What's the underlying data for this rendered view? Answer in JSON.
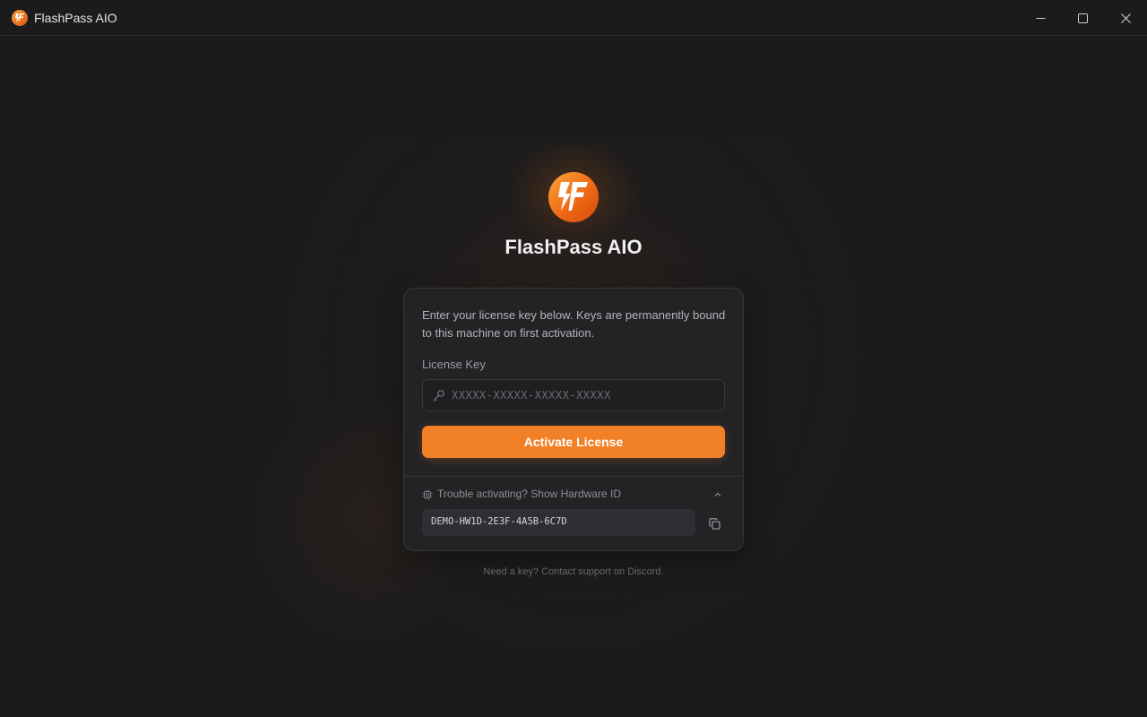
{
  "window": {
    "title": "FlashPass AIO",
    "controls": {
      "minimize": "minimize-icon",
      "maximize": "maximize-icon",
      "close": "close-icon"
    }
  },
  "brand": {
    "name": "FlashPass AIO",
    "logo_icon": "lightning-logo-icon",
    "accent_color": "#f28026"
  },
  "card": {
    "description": "Enter your license key below. Keys are permanently bound to this machine on first activation.",
    "license_label": "License Key",
    "license_placeholder": "XXXXX-XXXXX-XXXXX-XXXXX",
    "license_value": "",
    "activate_label": "Activate License",
    "trouble_label": "Trouble activating? Show Hardware ID",
    "hardware_id": "DEMO-HW1D-2E3F-4A5B-6C7D"
  },
  "footer": {
    "text": "Need a key? Contact support on Discord."
  }
}
